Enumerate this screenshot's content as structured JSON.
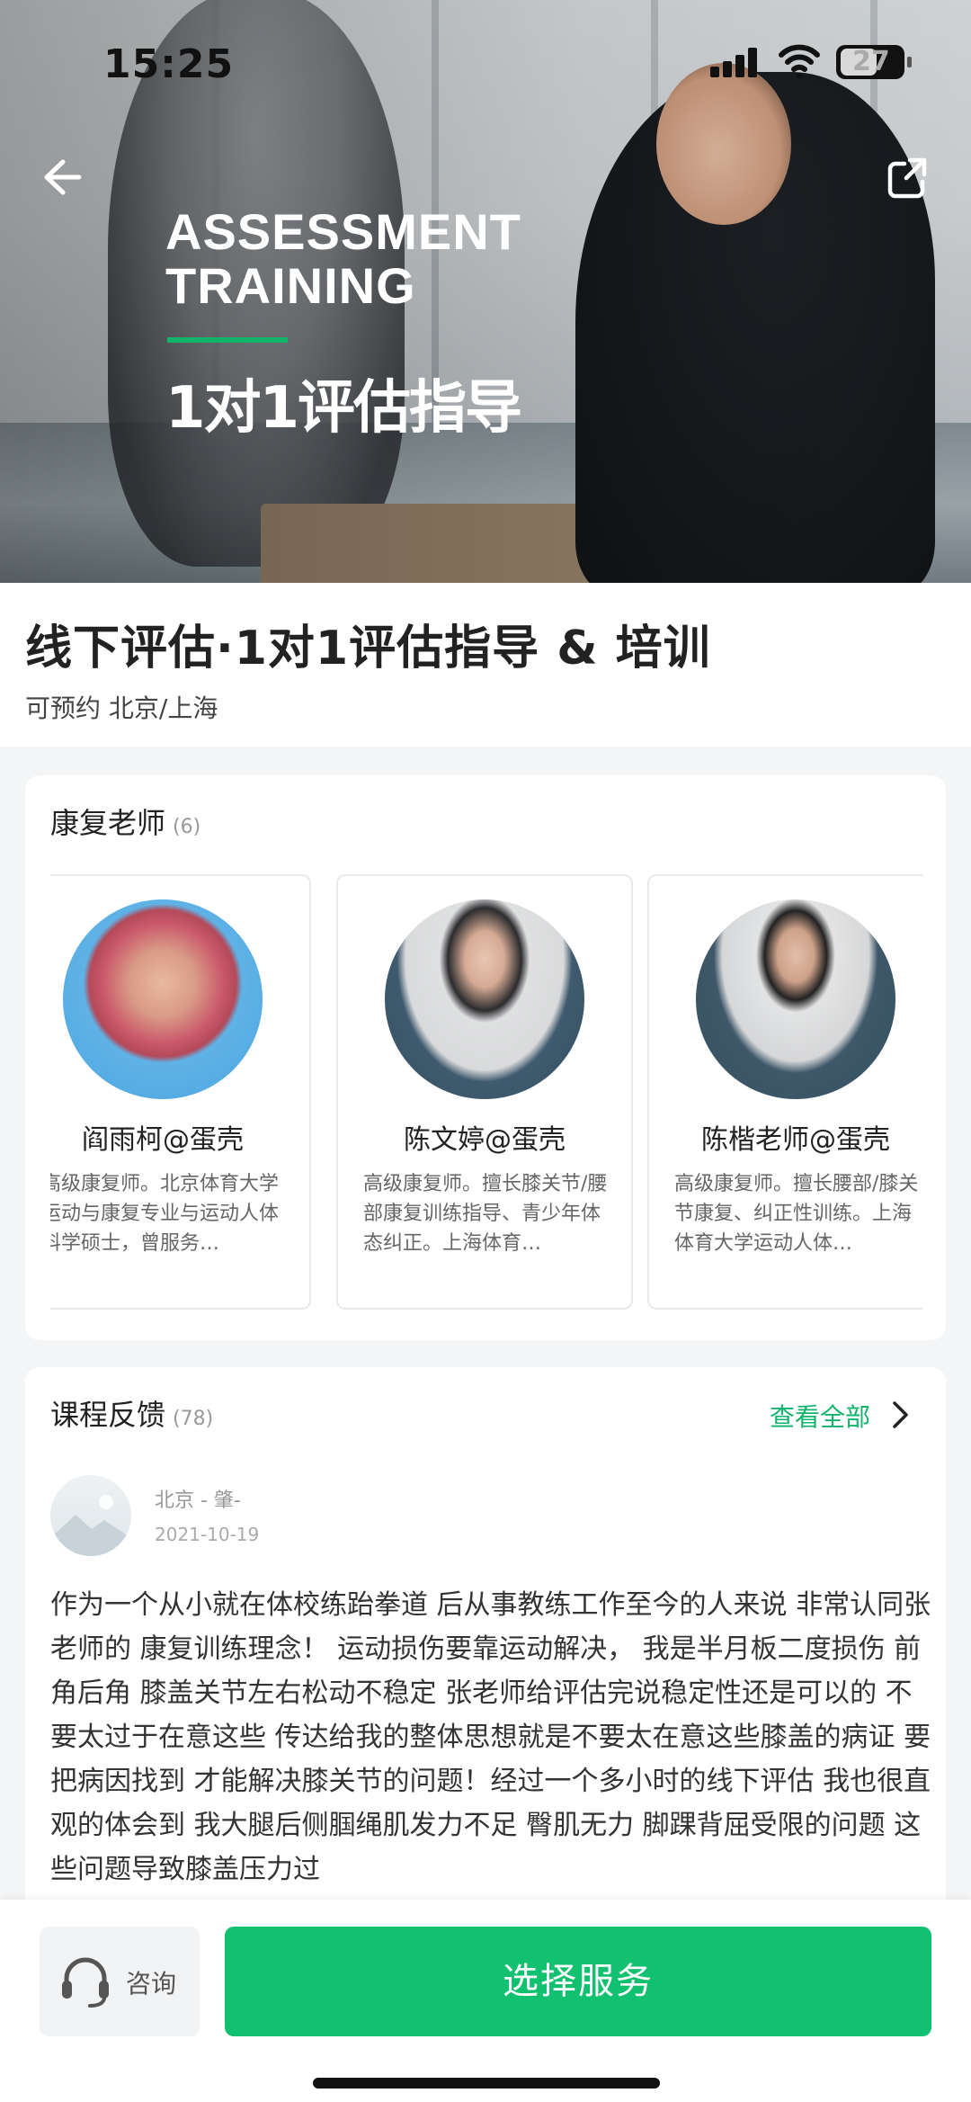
{
  "status": {
    "time": "15:25",
    "battery": "27"
  },
  "hero": {
    "title_line1": "ASSESSMENT",
    "title_line2": "TRAINING",
    "subtitle": "1对1评估指导"
  },
  "course": {
    "title": "线下评估·1对1评估指导 & 培训",
    "availability": "可预约 北京/上海"
  },
  "teachers": {
    "heading": "康复老师",
    "count": "(6)",
    "items": [
      {
        "name": "阎雨柯@蛋壳",
        "desc": "高级康复师。北京体育大学运动与康复专业与运动人体科学硕士，曾服务…"
      },
      {
        "name": "陈文婷@蛋壳",
        "desc": "高级康复师。擅长膝关节/腰部康复训练指导、青少年体态纠正。上海体育…"
      },
      {
        "name": "陈楷老师@蛋壳",
        "desc": "高级康复师。擅长腰部/膝关节康复、纠正性训练。上海体育大学运动人体…"
      }
    ]
  },
  "feedback": {
    "heading": "课程反馈",
    "count": "(78)",
    "view_all": "查看全部",
    "review": {
      "user": "北京 - 肇-",
      "date": "2021-10-19",
      "text": "作为一个从小就在体校练跆拳道  后从事教练工作至今的人来说 非常认同张老师的 康复训练理念！ 运动损伤要靠运动解决， 我是半月板二度损伤 前角后角 膝盖关节左右松动不稳定 张老师给评估完说稳定性还是可以的  不要太过于在意这些  传达给我的整体思想就是不要太在意这些膝盖的病证 要把病因找到 才能解决膝关节的问题！经过一个多小时的线下评估 我也很直观的体会到 我大腿后侧腘绳肌发力不足 臀肌无力  脚踝背屈受限的问题  这些问题导致膝盖压力过"
    }
  },
  "bottom": {
    "consult_label": "咨询",
    "select_label": "选择服务"
  },
  "colors": {
    "accent": "#12b36b",
    "button": "#12c16f"
  }
}
